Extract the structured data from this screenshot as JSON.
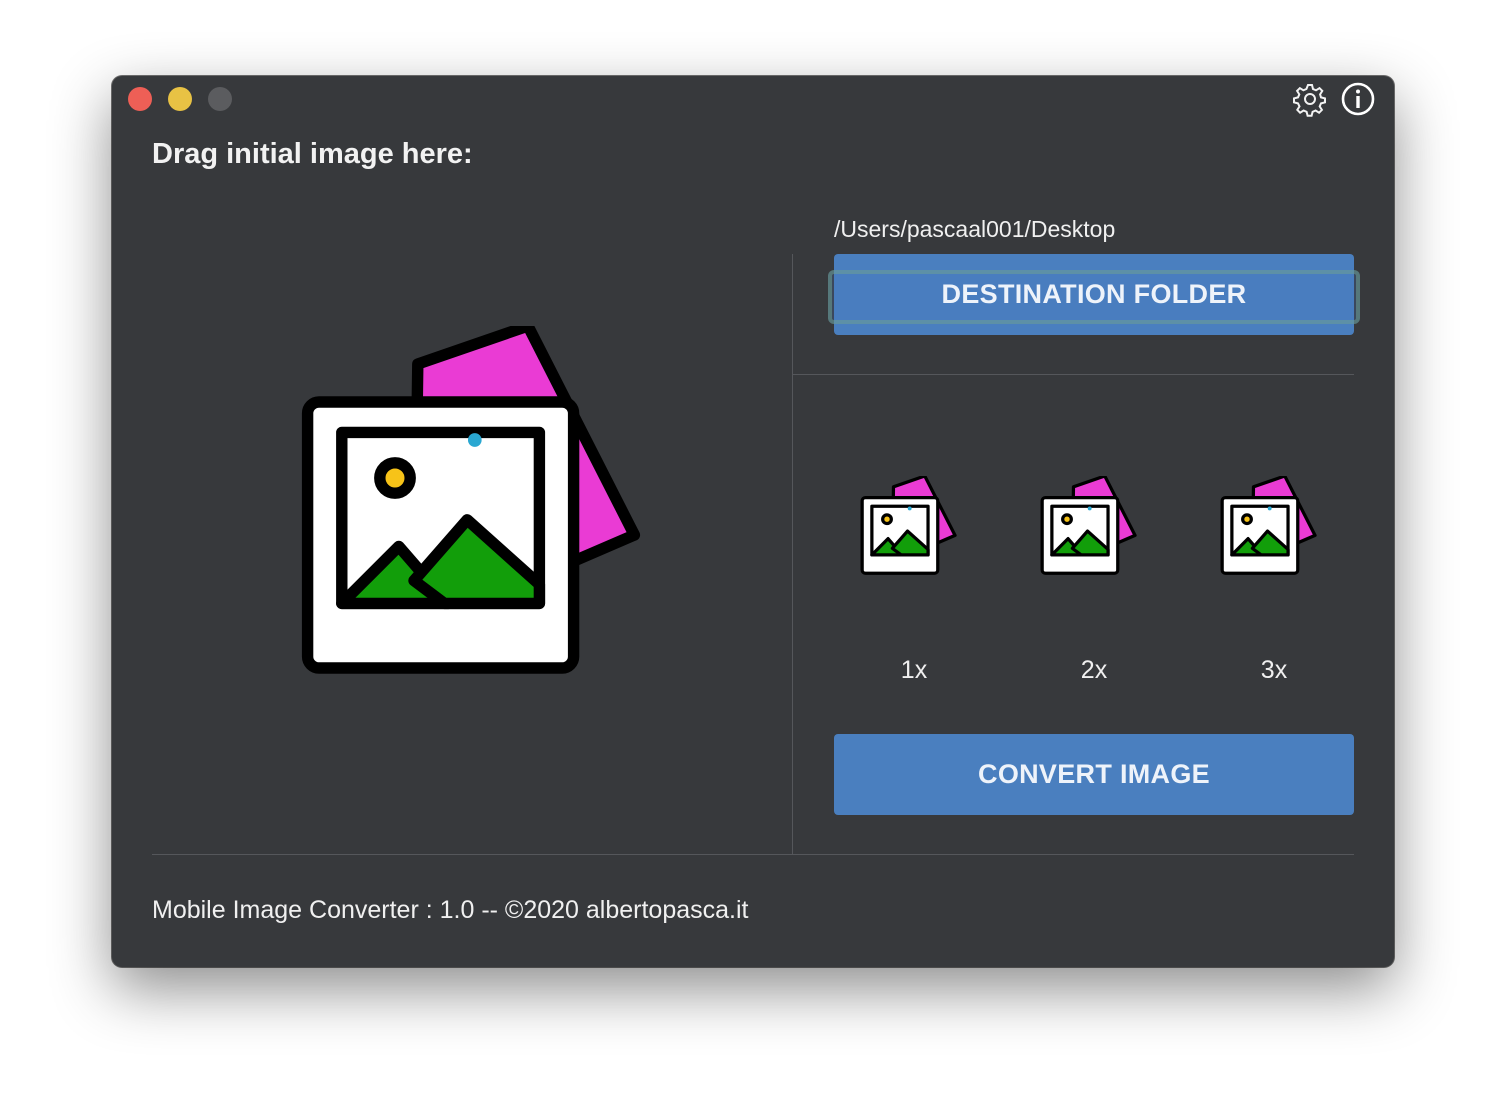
{
  "window": {
    "controls": [
      "close",
      "minimize",
      "zoom"
    ],
    "toolbar_icons": [
      "gear-icon",
      "info-icon"
    ]
  },
  "drop_zone": {
    "label": "Drag initial image here:",
    "placeholder_icon": "photos-icon"
  },
  "destination": {
    "path": "/Users/pascaal001/Desktop",
    "button_label": "DESTINATION FOLDER"
  },
  "scales": [
    {
      "label": "1x",
      "icon": "photos-icon"
    },
    {
      "label": "2x",
      "icon": "photos-icon"
    },
    {
      "label": "3x",
      "icon": "photos-icon"
    }
  ],
  "convert": {
    "button_label": "CONVERT IMAGE"
  },
  "footer": {
    "text": "Mobile Image Converter : 1.0 -- ©2020 albertopasca.it"
  },
  "colors": {
    "background": "#37393c",
    "button": "#4a7fbf",
    "photo_back": "#ea3bd4",
    "mountain": "#129e0a",
    "sun": "#f7c318",
    "dot": "#2aa7d1"
  }
}
